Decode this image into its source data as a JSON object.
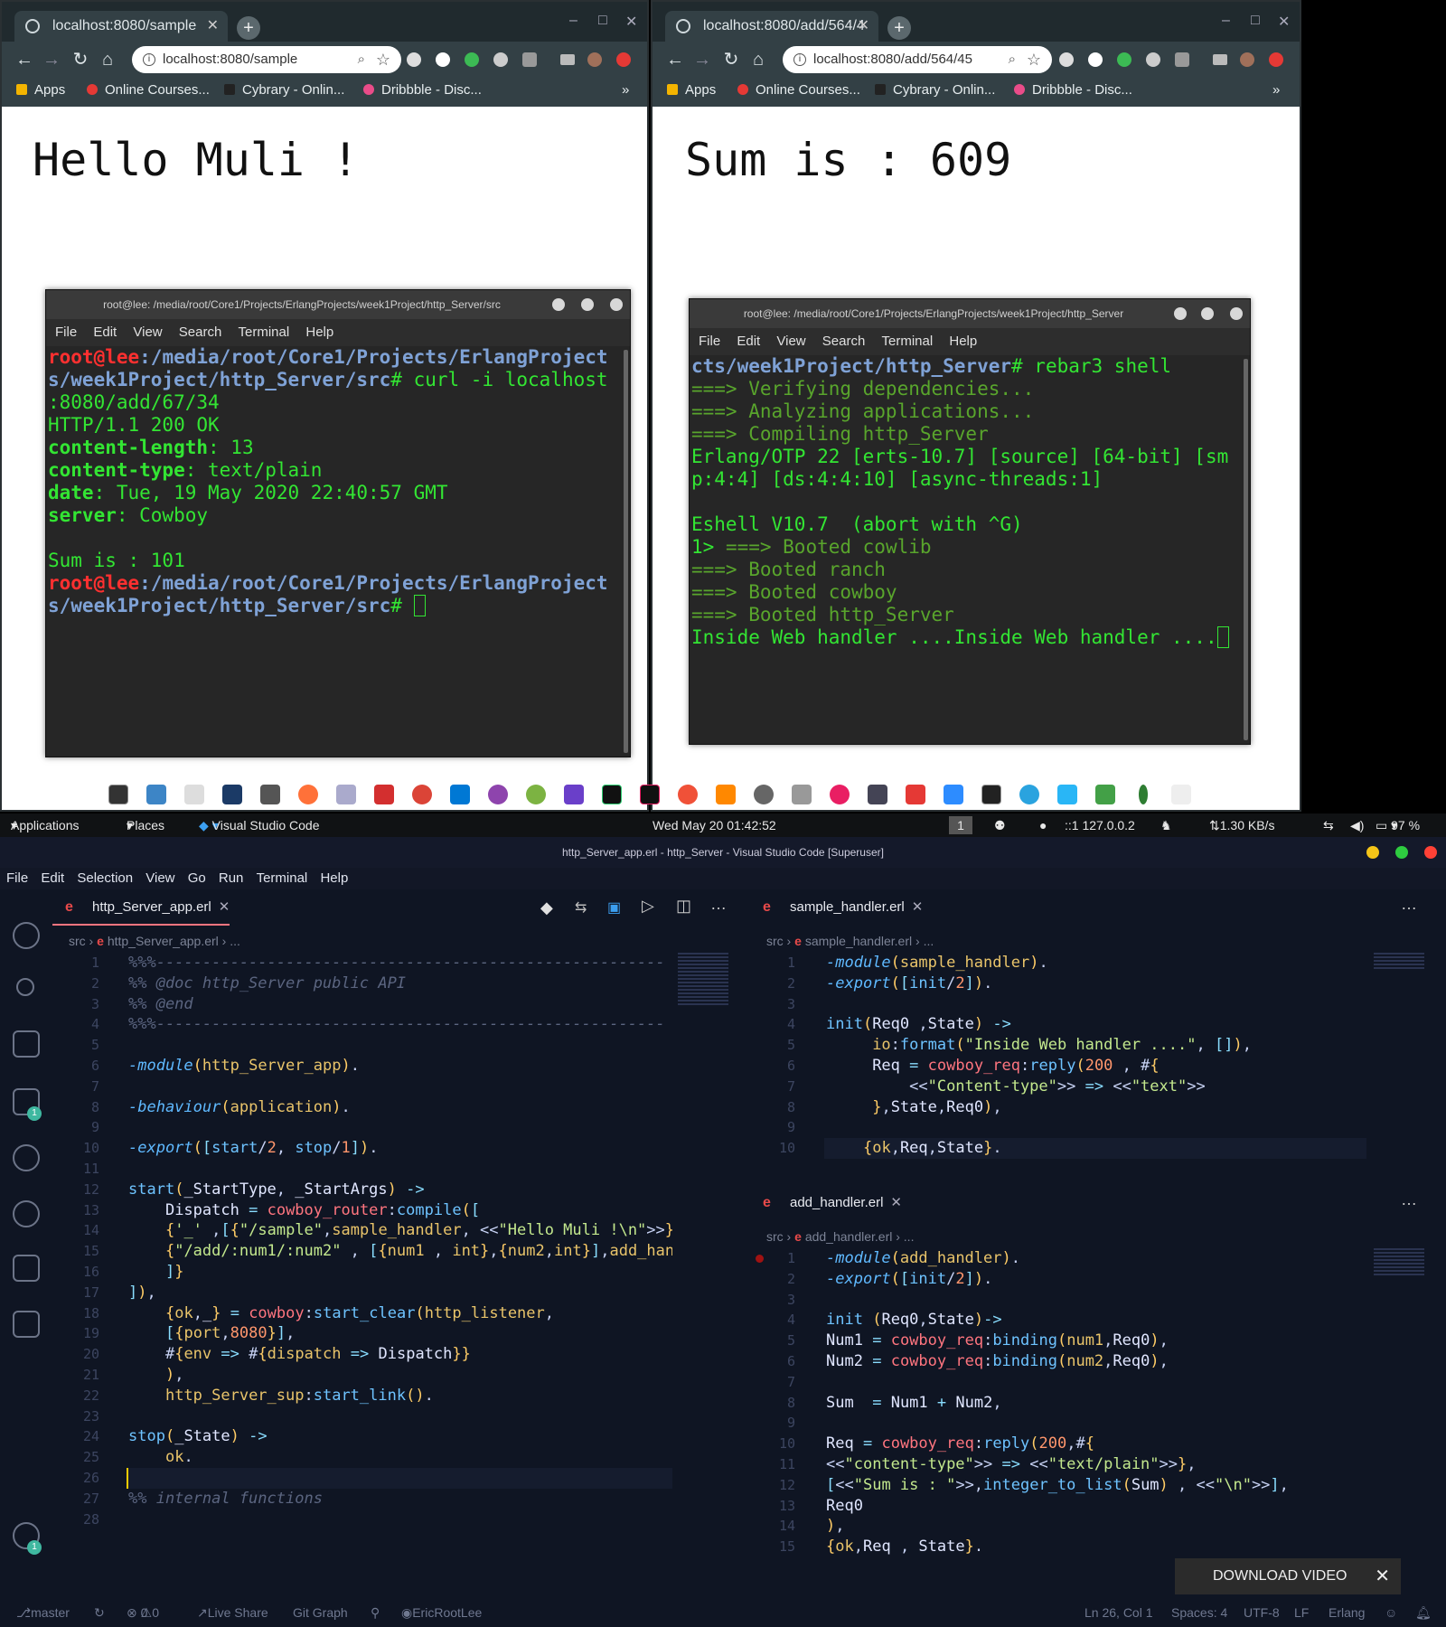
{
  "browser_left": {
    "tab_title": "localhost:8080/sample",
    "url": "localhost:8080/sample",
    "bookmarks": [
      "Apps",
      "Online Courses...",
      "Cybrary - Onlin...",
      "Dribbble - Disc..."
    ],
    "content": "Hello Muli !"
  },
  "browser_right": {
    "tab_title": "localhost:8080/add/564/4",
    "url": "localhost:8080/add/564/45",
    "bookmarks": [
      "Apps",
      "Online Courses...",
      "Cybrary - Onlin...",
      "Dribbble - Disc..."
    ],
    "content": "Sum is : 609"
  },
  "terminal_left": {
    "title": "root@lee: /media/root/Core1/Projects/ErlangProjects/week1Project/http_Server/src",
    "menu": [
      "File",
      "Edit",
      "View",
      "Search",
      "Terminal",
      "Help"
    ],
    "prompt_user": "root@lee",
    "path_1": ":/media/root/Core1/Projects/ErlangProject",
    "path_2": "s/week1Project/http_Server/src",
    "cmd_suffix": "# curl -i localhost",
    "cmd_cont": ":8080/add/67/34",
    "status": "HTTP/1.1 200 OK",
    "h1_k": "content-length",
    "h1_v": ": 13",
    "h2_k": "content-type",
    "h2_v": ": text/plain",
    "h3_k": "date",
    "h3_v": ": Tue, 19 May 2020 22:40:57 GMT",
    "h4_k": "server",
    "h4_v": ": Cowboy",
    "body": "Sum is : 101",
    "prompt2_path_1": ":/media/root/Core1/Projects/ErlangProject",
    "prompt2_path_2": "s/week1Project/http_Server/src",
    "prompt2_end": "# "
  },
  "terminal_right": {
    "title": "root@lee: /media/root/Core1/Projects/ErlangProjects/week1Project/http_Server",
    "menu": [
      "File",
      "Edit",
      "View",
      "Search",
      "Terminal",
      "Help"
    ],
    "line1_path": "cts/week1Project/http_Server",
    "line1_cmd": "# rebar3 shell",
    "lines_dim": [
      "===> Verifying dependencies...",
      "===> Analyzing applications...",
      "===> Compiling http_Server"
    ],
    "erlang_1": "Erlang/OTP 22 [erts-10.7] [source] [64-bit] [sm",
    "erlang_2": "p:4:4] [ds:4:4:10] [async-threads:1]",
    "eshell": "Eshell V10.7  (abort with ^G)",
    "boot_prefix": "1> ",
    "boot": [
      "===> Booted cowlib",
      "===> Booted ranch",
      "===> Booted cowboy",
      "===> Booted http_Server"
    ],
    "inside": "Inside Web handler ....Inside Web handler ...."
  },
  "topbar": {
    "applications": "Applications",
    "places": "Places",
    "app": "Visual Studio Code",
    "clock": "Wed May 20  01:42:52",
    "workspace": "1",
    "ip": "::1 127.0.0.2",
    "net": "1.30 KB/s",
    "battery": "97 %"
  },
  "vscode": {
    "title": "http_Server_app.erl - http_Server - Visual Studio Code [Superuser]",
    "menu": [
      "File",
      "Edit",
      "Selection",
      "View",
      "Go",
      "Run",
      "Terminal",
      "Help"
    ],
    "left_tab": "http_Server_app.erl",
    "left_crumb_1": "src",
    "left_crumb_2": "http_Server_app.erl",
    "left_crumb_3": "...",
    "left_lines": "1\n2\n3\n4\n5\n6\n7\n8\n9\n10\n11\n12\n13\n14\n15\n16\n17\n18\n19\n20\n21\n22\n23\n24\n25\n26\n27\n28",
    "sample_tab": "sample_handler.erl",
    "sample_crumb_1": "src",
    "sample_crumb_2": "sample_handler.erl",
    "sample_crumb_3": "...",
    "sample_lines": "1\n2\n3\n4\n5\n6\n7\n8\n9\n10",
    "add_tab": "add_handler.erl",
    "add_crumb_1": "src",
    "add_crumb_2": "add_handler.erl",
    "add_crumb_3": "...",
    "add_lines": "1\n2\n3\n4\n5\n6\n7\n8\n9\n10\n11\n12\n13\n14\n15",
    "activity_badge": "1",
    "settings_badge": "1"
  },
  "statusbar": {
    "branch": "master",
    "errors": "0",
    "warnings": "0",
    "liveshare": "Live Share",
    "gitgraph": "Git Graph",
    "user": "EricRootLee",
    "position": "Ln 26, Col 1",
    "spaces": "Spaces: 4",
    "encoding": "UTF-8",
    "eol": "LF",
    "language": "Erlang"
  },
  "download_video": "DOWNLOAD VIDEO",
  "colors": {
    "terminal_green": "#33e533",
    "prompt_red": "#ff3030",
    "path_blue": "#7fa2d6",
    "vscode_bg": "#0f1523",
    "browser_chrome": "#334045"
  }
}
